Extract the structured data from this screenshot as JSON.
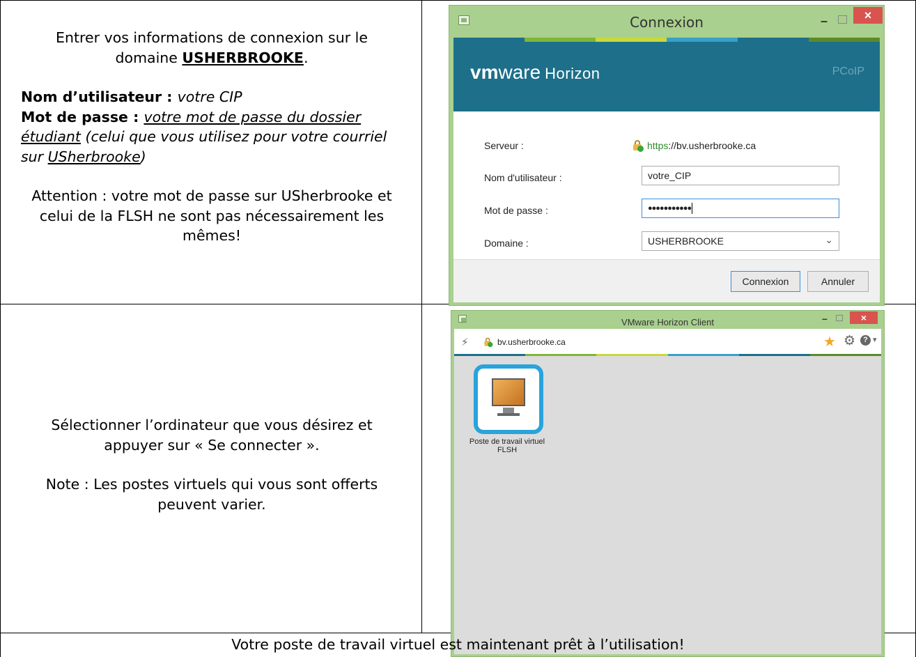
{
  "row1": {
    "intro_prefix": "Entrer vos informations de connexion sur le domaine ",
    "domain_name": "USHERBROOKE",
    "intro_suffix": ".",
    "username_label": "Nom d’utilisateur : ",
    "username_value": "votre CIP",
    "password_label": "Mot de passe : ",
    "password_value_underlined": "votre mot de passe du dossier étudiant",
    "password_note_prefix": " (celui que vous utilisez pour votre courriel sur ",
    "password_note_link": "USherbrooke",
    "password_note_suffix": ")",
    "warning": "Attention : votre mot de passe sur USherbrooke et celui de la FLSH ne sont pas nécessairement les mêmes!"
  },
  "login_window": {
    "title": "Connexion",
    "brand_vm": "vm",
    "brand_ware": "ware",
    "brand_product": "Horizon",
    "pcoip": "PCoIP",
    "server_label": "Serveur :",
    "server_protocol": "https",
    "server_rest": "://bv.usherbrooke.ca",
    "username_label": "Nom d'utilisateur :",
    "username_value": "votre_CIP",
    "password_label": "Mot de passe :",
    "password_value": "●●●●●●●●●●●",
    "domain_label": "Domaine :",
    "domain_value": "USHERBROOKE",
    "connect_button": "Connexion",
    "cancel_button": "Annuler",
    "minimize_glyph": "–",
    "close_glyph": "×",
    "icons": [
      "window-app-icon",
      "lock-check-icon",
      "chevron-down-icon",
      "minimize-icon",
      "maximize-icon",
      "close-icon"
    ]
  },
  "row2": {
    "instruction": "Sélectionner l’ordinateur que vous désirez et appuyer sur « Se connecter ».",
    "note": "Note : Les postes virtuels qui vous sont offerts peuvent varier."
  },
  "client_window": {
    "title": "VMware Horizon Client",
    "address": "bv.usherbrooke.ca",
    "desktop_label": "Poste de travail virtuel FLSH",
    "minimize_glyph": "–",
    "close_glyph": "×",
    "icons": [
      "plug-icon",
      "star-icon",
      "gear-icon",
      "help-icon",
      "desktop-icon"
    ]
  },
  "row3": {
    "ready": "Votre poste de travail virtuel est maintenant prêt à l’utilisation!"
  },
  "colors": {
    "window_frame": "#a9d08e",
    "vmware_banner": "#1d6f8a",
    "tile_border": "#29a3dc",
    "close_button": "#d9534f",
    "stripe": [
      "#1d6f8a",
      "#7fb539",
      "#c9d83a",
      "#3aa0c9",
      "#1d6f8a",
      "#5a8a2a"
    ]
  }
}
